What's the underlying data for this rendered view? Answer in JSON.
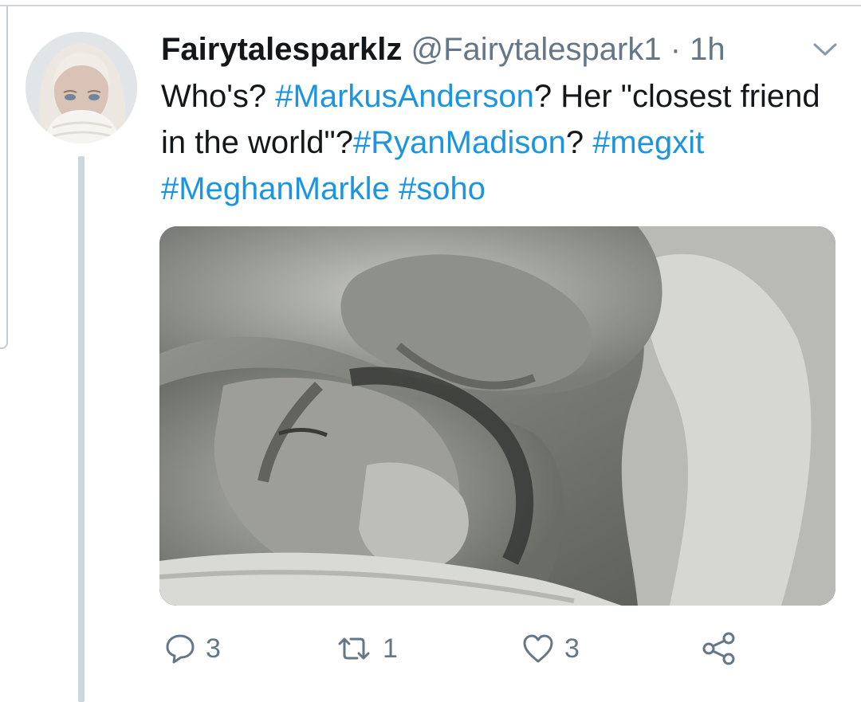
{
  "tweet": {
    "display_name": "Fairytalesparklz",
    "handle": "@Fairytalespark1",
    "separator": "·",
    "time": "1h",
    "text_parts": [
      {
        "text": "Who's? ",
        "type": "plain"
      },
      {
        "text": "#MarkusAnderson",
        "type": "hashtag"
      },
      {
        "text": "? Her \"closest friend in the world\"?",
        "type": "plain"
      },
      {
        "text": "#RyanMadison",
        "type": "hashtag"
      },
      {
        "text": "? ",
        "type": "plain"
      },
      {
        "text": "#megxit",
        "type": "hashtag"
      },
      {
        "text": " ",
        "type": "plain"
      },
      {
        "text": "#MeghanMarkle",
        "type": "hashtag"
      },
      {
        "text": " ",
        "type": "plain"
      },
      {
        "text": "#soho",
        "type": "hashtag"
      }
    ]
  },
  "actions": {
    "reply": {
      "icon": "reply-icon",
      "count": "3"
    },
    "retweet": {
      "icon": "retweet-icon",
      "count": "1"
    },
    "like": {
      "icon": "heart-icon",
      "count": "3"
    },
    "share": {
      "icon": "share-icon"
    }
  },
  "colors": {
    "text": "#14171a",
    "secondary": "#657786",
    "link": "#1b95e0",
    "thread_line": "#ccd6dd"
  }
}
